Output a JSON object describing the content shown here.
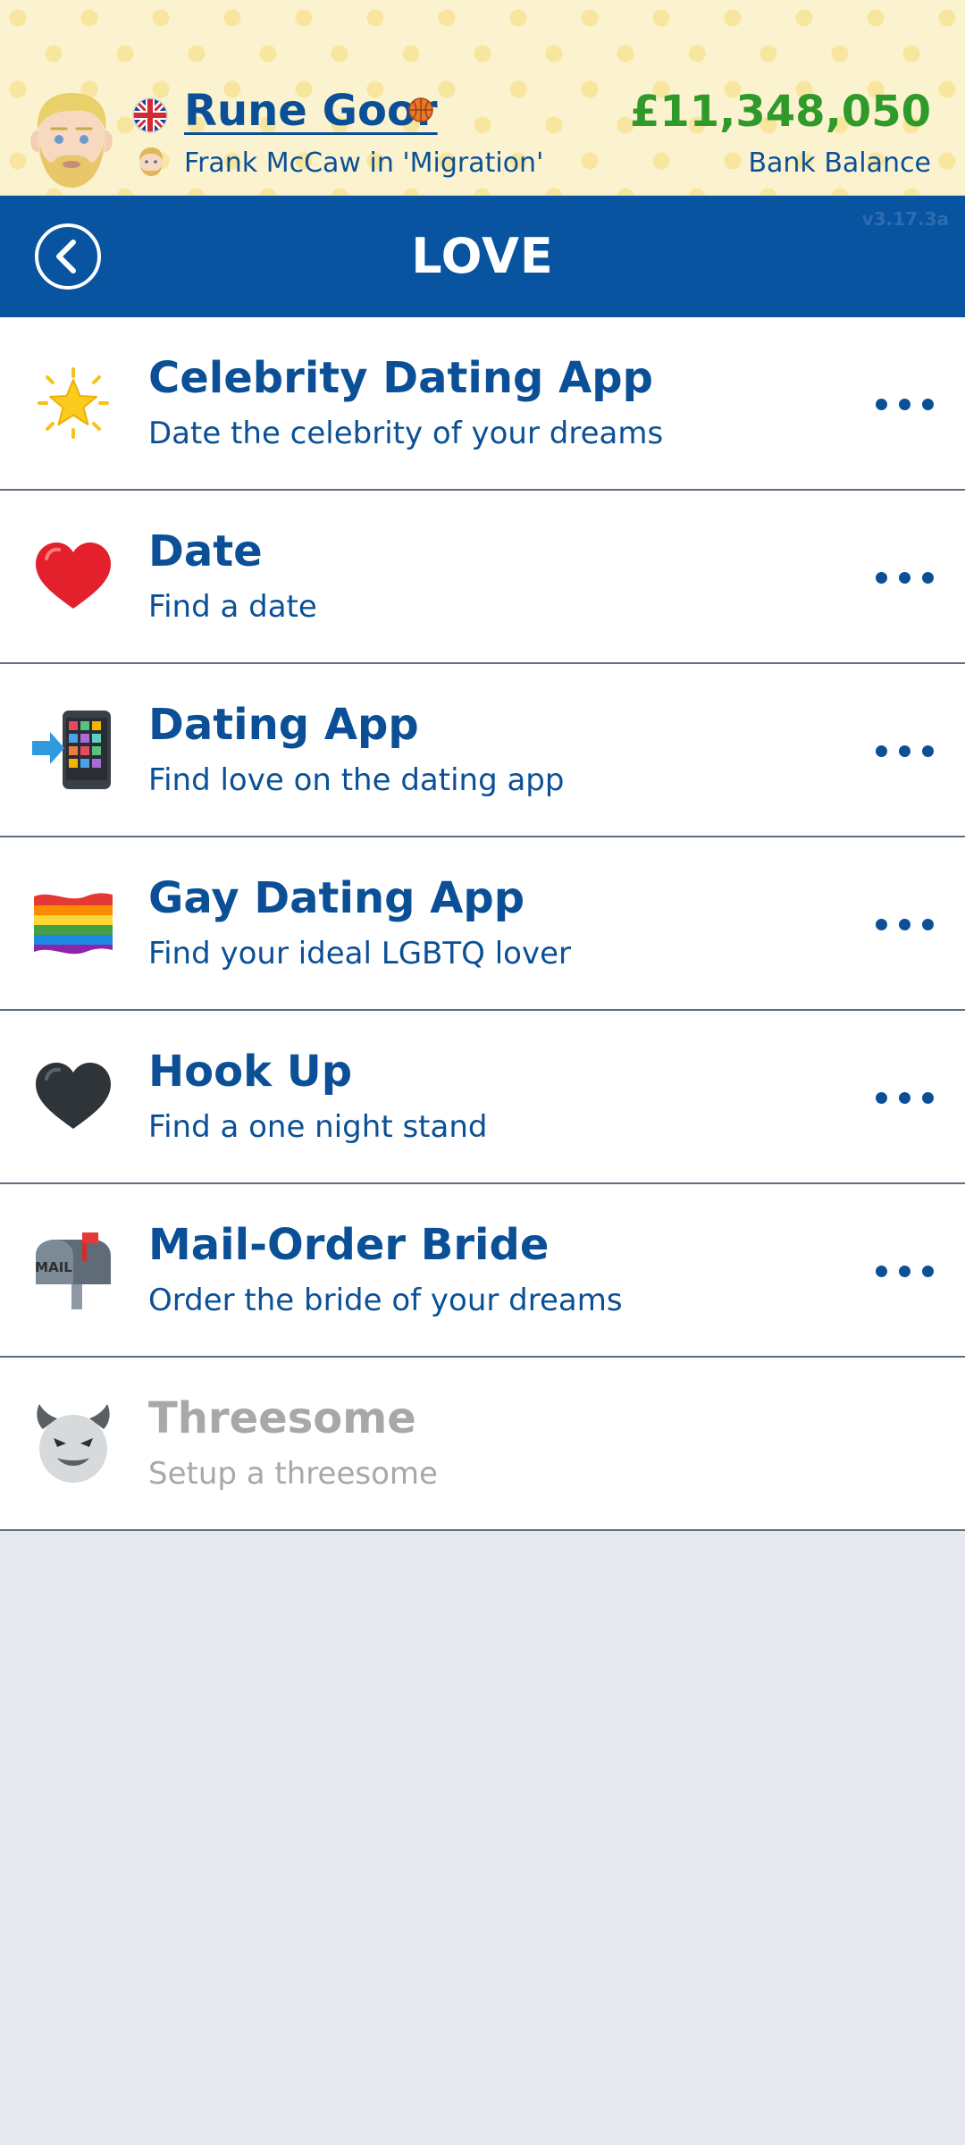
{
  "header": {
    "player_name": "Rune Goor",
    "role": "Frank McCaw in 'Migration'",
    "balance": "£11,348,050",
    "balance_label": "Bank Balance",
    "avatar_icon": "blond-bearded-man-avatar",
    "flag_icon": "uk-flag-icon",
    "sport_icon": "basketball-icon"
  },
  "nav": {
    "title": "LOVE",
    "version": "v3.17.3a",
    "back_icon": "back-arrow-icon"
  },
  "items": [
    {
      "title": "Celebrity Dating App",
      "subtitle": "Date the celebrity of your dreams",
      "icon": "glowing-star-icon",
      "enabled": true
    },
    {
      "title": "Date",
      "subtitle": "Find a date",
      "icon": "red-heart-icon",
      "enabled": true
    },
    {
      "title": "Dating App",
      "subtitle": "Find love on the dating app",
      "icon": "mobile-phone-arrow-icon",
      "enabled": true
    },
    {
      "title": "Gay Dating App",
      "subtitle": "Find your ideal LGBTQ lover",
      "icon": "rainbow-flag-icon",
      "enabled": true
    },
    {
      "title": "Hook Up",
      "subtitle": "Find a one night stand",
      "icon": "black-heart-icon",
      "enabled": true
    },
    {
      "title": "Mail-Order Bride",
      "subtitle": "Order the bride of your dreams",
      "icon": "mailbox-icon",
      "enabled": true
    },
    {
      "title": "Threesome",
      "subtitle": "Setup a threesome",
      "icon": "devil-face-icon",
      "enabled": false
    }
  ],
  "colors": {
    "brand_blue": "#0854a0",
    "text_blue": "#0b5096",
    "money_green": "#2f9a2a",
    "disabled_gray": "#a9a7a7",
    "header_cream": "#fbf3cf",
    "background": "#e6eaee"
  }
}
